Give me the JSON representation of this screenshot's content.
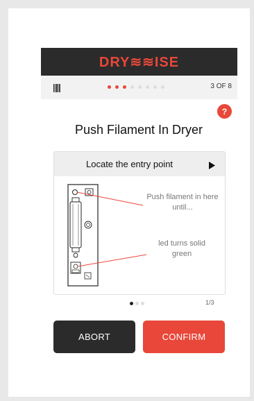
{
  "brand": {
    "logo_text": "DRY≋≋ISE",
    "accent_color": "#e8473a",
    "bar_color": "#2b2b2b"
  },
  "progress": {
    "step_text": "3 OF 8",
    "current_step": 3,
    "total_steps": 8
  },
  "help": {
    "label": "?"
  },
  "title": "Push Filament In Dryer",
  "panel": {
    "header_label": "Locate the entry point",
    "callouts": [
      "Push filament in here until...",
      "led turns solid green"
    ]
  },
  "carousel": {
    "current": 1,
    "total": 3,
    "indicator": "1/3"
  },
  "buttons": {
    "abort_label": "ABORT",
    "confirm_label": "CONFIRM"
  },
  "icons": {
    "barcode": "barcode-icon",
    "play": "play-icon"
  }
}
